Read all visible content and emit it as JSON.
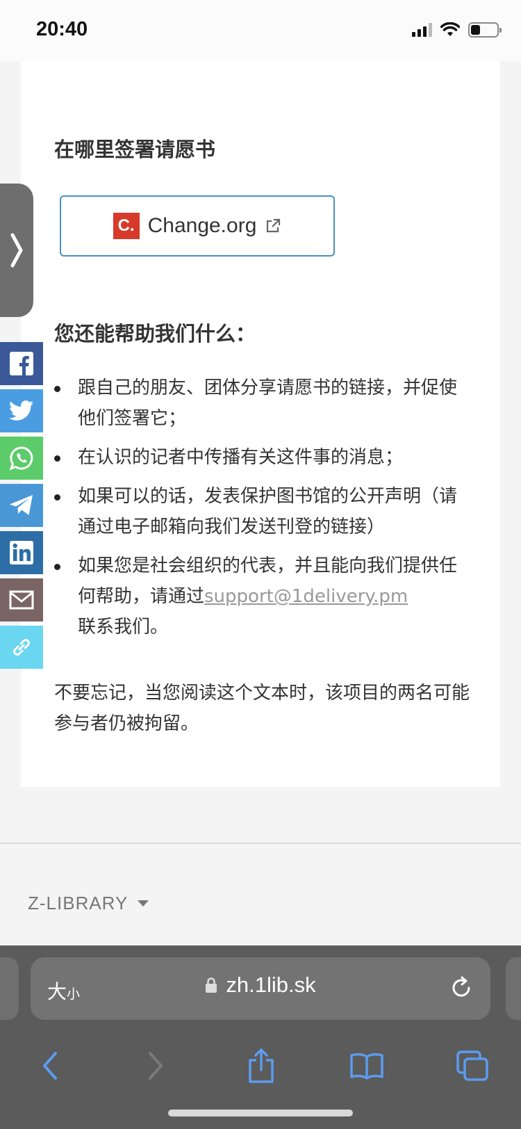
{
  "status": {
    "time": "20:40",
    "battery_level": 0.35
  },
  "content": {
    "sign_heading": "在哪里签署请愿书",
    "petition_logo": "C.",
    "petition_button_label": "Change.org",
    "help_heading": "您还能帮助我们什么：",
    "help_items": [
      "跟自己的朋友、团体分享请愿书的链接，并促使他们签署它；",
      "在认识的记者中传播有关这件事的消息；",
      "如果可以的话，发表保护图书馆的公开声明（请通过电子邮箱向我们发送刊登的链接）"
    ],
    "contact_item": {
      "prefix": "如果您是社会组织的代表，并且能向我们提供任何帮助，请通过",
      "email": "support@1delivery.pm",
      "suffix": "联系我们。"
    },
    "reminder": "不要忘记，当您阅读这个文本时，该项目的两名可能参与者仍被拘留。"
  },
  "side_toggle": {
    "icon": "chevron-right-icon"
  },
  "share_buttons": [
    {
      "name": "facebook-share-button",
      "icon": "facebook-icon",
      "color": "#3b5998"
    },
    {
      "name": "twitter-share-button",
      "icon": "twitter-icon",
      "color": "#4a9de0"
    },
    {
      "name": "whatsapp-share-button",
      "icon": "whatsapp-icon",
      "color": "#5ccb6a"
    },
    {
      "name": "telegram-share-button",
      "icon": "telegram-icon",
      "color": "#4a97d6"
    },
    {
      "name": "linkedin-share-button",
      "icon": "linkedin-icon",
      "color": "#2d6ea6"
    },
    {
      "name": "email-share-button",
      "icon": "mail-icon",
      "color": "#7a6464"
    },
    {
      "name": "copy-link-button",
      "icon": "link-icon",
      "color": "#6ad6f0"
    }
  ],
  "footer": {
    "brand": "Z-LIBRARY"
  },
  "browser": {
    "text_size_large": "大",
    "text_size_small": "小",
    "url": "zh.1lib.sk",
    "accent_color": "#5b9cf0"
  }
}
